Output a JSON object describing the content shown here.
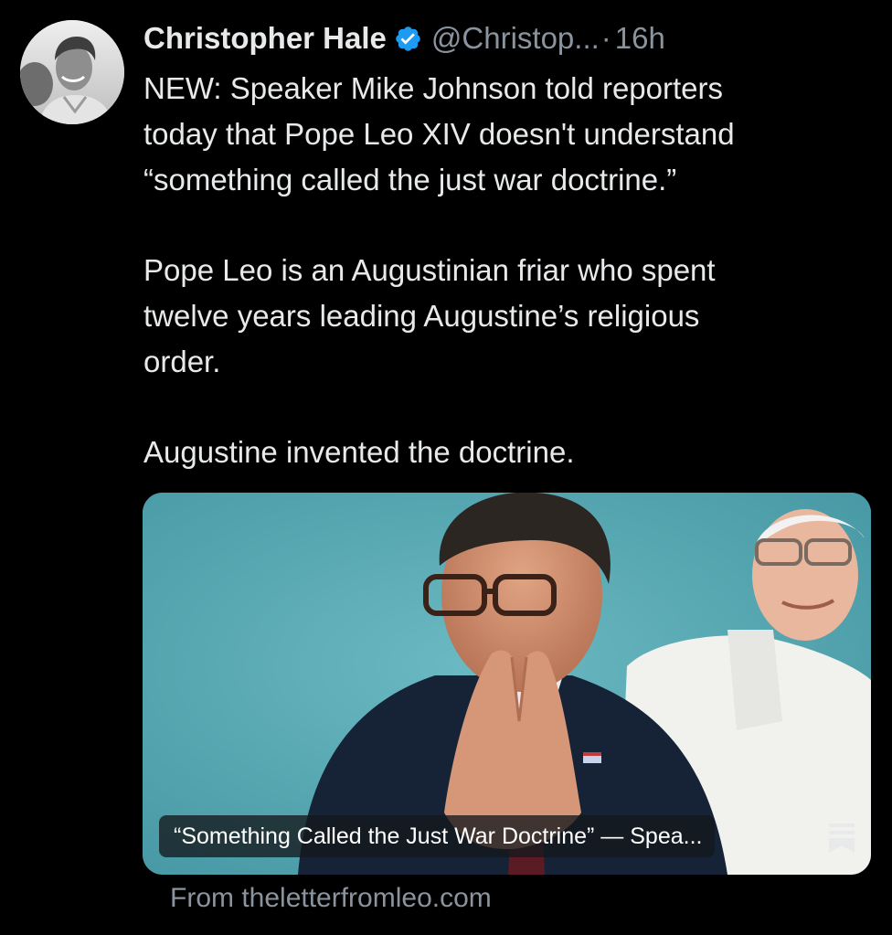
{
  "author": {
    "display_name": "Christopher Hale",
    "verified": true,
    "handle": "@Christop...",
    "separator": "·",
    "timestamp": "16h"
  },
  "tweet": {
    "paragraphs": [
      "NEW: Speaker Mike Johnson told reporters\ntoday that Pope Leo XIV doesn't understand\n“something called the just war doctrine.”",
      "Pope Leo is an Augustinian friar who spent\ntwelve years leading Augustine’s religious\norder.",
      "Augustine invented the doctrine."
    ]
  },
  "link_card": {
    "title": "“Something Called the Just War Doctrine” — Spea...",
    "source": "From theletterfromleo.com",
    "icon": "substack-bookmark-icon"
  },
  "colors": {
    "background": "#000000",
    "text": "#e7e9ea",
    "muted": "#8b949e",
    "verified": "#1d9bf0",
    "card_background": "#57a9b4"
  },
  "icons": {
    "verified": "verified-badge-icon",
    "avatar": "profile-photo"
  }
}
